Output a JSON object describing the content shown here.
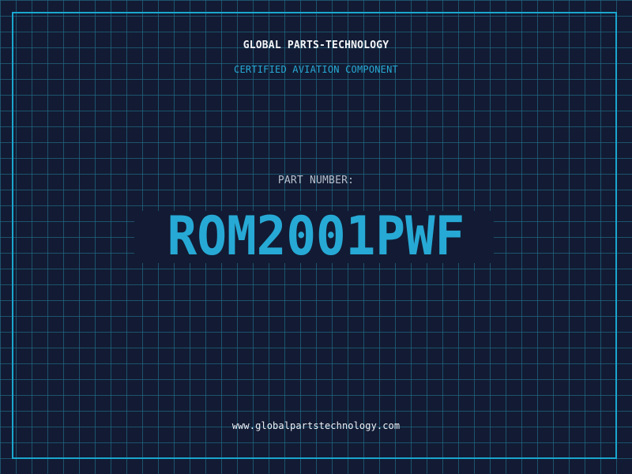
{
  "header": {
    "title": "GLOBAL PARTS-TECHNOLOGY",
    "subtitle": "CERTIFIED AVIATION COMPONENT"
  },
  "part": {
    "label": "PART NUMBER:",
    "number": "ROM2001PWF"
  },
  "footer": {
    "website": "www.globalpartstechnology.com"
  },
  "colors": {
    "background": "#121b33",
    "grid": "#216784",
    "accent": "#1aa6cf",
    "primary_text": "#f2f5f8",
    "secondary_text": "#b6c0cd"
  }
}
